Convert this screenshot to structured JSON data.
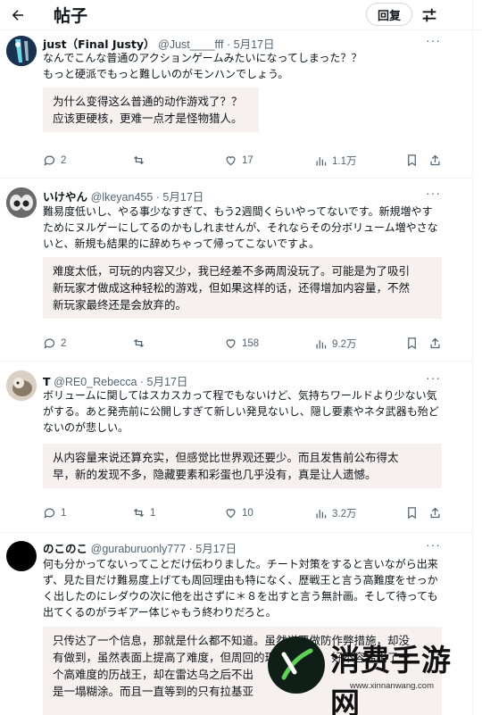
{
  "header": {
    "back_icon": "arrow-left-icon",
    "title": "帖子",
    "reply_label": "回复",
    "filter_icon": "sliders-icon"
  },
  "tweets": [
    {
      "name": "just（Final Justy）",
      "handle": "@Just____fff · 5月17日",
      "jp": "なんでこんな普通のアクションゲームみたいになってしまった？？\nもっと硬派でもっと難しいのがモンハンでしょう。",
      "cn": "为什么变得这么普通的动作游戏了？？\n应该更硬核，更难一点才是怪物猎人。",
      "replies": "2",
      "retweets": "",
      "likes": "17",
      "views": "1.1万"
    },
    {
      "name": "いけやん",
      "handle": "@lkeyan455 · 5月17日",
      "jp": "難易度低いし、やる事少なすぎて、もう2週間くらいやってないです。新規増やすためにヌルゲーにしてるのかもしれませんが、それならその分ボリューム増やさないと、新規も結果的に辞めちゃって帰ってこないですよ。",
      "cn": "难度太低，可玩的内容又少，我已经差不多两周没玩了。可能是为了吸引\n新玩家才做成这种轻松的游戏，但如果这样的话，还得增加内容量，不然\n新玩家最终还是会放弃的。",
      "replies": "2",
      "retweets": "",
      "likes": "158",
      "views": "9.2万"
    },
    {
      "name": "T",
      "handle": "@RE0_Rebecca · 5月17日",
      "jp": "ボリュームに関してはスカスカって程でもないけど、気持ちワールドより少ない気がする。あと発売前に公開しすぎて新しい発見ないし、隠し要素やネタ武器も殆どないのが悲しい。",
      "cn": "从内容量来说还算充实，但感觉比世界观还要少。而且发售前公布得太\n早，新的发现不多，隐藏要素和彩蛋也几乎没有，真是让人遗憾。",
      "replies": "1",
      "retweets": "1",
      "likes": "10",
      "views": "3.2万"
    },
    {
      "name": "のこのこ",
      "handle": "@guraburuonly777 · 5月17日",
      "jp": "何も分かってないってことだけ伝わりました。チート対策をすると言いながら出来ず、見た目だけ難易度上げても周回理由も特になく、歴戦王と言う高難度をせっかく出したのにレダウの次に他を出さずに＊８を出すと言う無計画。そして待っても出てくるのがラギアー体じゃもう終わりだろと。",
      "cn": "只传达了一个信息，那就是什么都不知道。虽然说要做防作弊措施，却没\n有做到，虽然表面上提高了难度，但周回的理由却不多，好不容易出了一\n个高难度的历战王，却在雷达乌之后不出\n是一塌糊涂。而且一直等到的只有拉基亚"
    }
  ],
  "watermark": {
    "text": "消费手游网",
    "url": "www.xinnanwang.com"
  }
}
